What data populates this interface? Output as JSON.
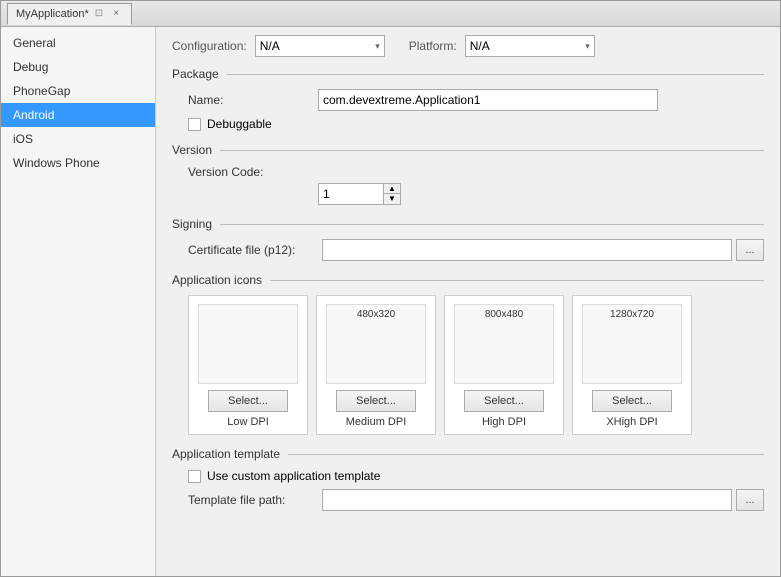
{
  "window": {
    "title": "MyApplication*",
    "close_label": "×",
    "pin_label": "📌"
  },
  "toolbar": {
    "configuration_label": "Configuration:",
    "configuration_value": "N/A",
    "platform_label": "Platform:",
    "platform_value": "N/A"
  },
  "sidebar": {
    "items": [
      {
        "id": "general",
        "label": "General",
        "active": false
      },
      {
        "id": "debug",
        "label": "Debug",
        "active": false
      },
      {
        "id": "phonegap",
        "label": "PhoneGap",
        "active": false
      },
      {
        "id": "android",
        "label": "Android",
        "active": true
      },
      {
        "id": "ios",
        "label": "iOS",
        "active": false
      },
      {
        "id": "windows-phone",
        "label": "Windows Phone",
        "active": false
      }
    ]
  },
  "sections": {
    "package": {
      "title": "Package",
      "name_label": "Name:",
      "name_value": "com.devextreme.Application1",
      "debuggable_label": "Debuggable"
    },
    "version": {
      "title": "Version",
      "version_code_label": "Version Code:",
      "version_code_value": "1"
    },
    "signing": {
      "title": "Signing",
      "certificate_label": "Certificate file (p12):",
      "certificate_value": "",
      "browse_label": "..."
    },
    "application_icons": {
      "title": "Application icons",
      "icons": [
        {
          "size": "",
          "dpi": "Low DPI",
          "select_label": "Select..."
        },
        {
          "size": "480x320",
          "dpi": "Medium DPI",
          "select_label": "Select..."
        },
        {
          "size": "800x480",
          "dpi": "High DPI",
          "select_label": "Select..."
        },
        {
          "size": "1280x720",
          "dpi": "XHigh DPI",
          "select_label": "Select..."
        }
      ]
    },
    "application_template": {
      "title": "Application template",
      "use_custom_label": "Use custom application template",
      "template_path_label": "Template file path:",
      "template_path_value": "",
      "browse_label": "..."
    }
  },
  "icons": {
    "dropdown_arrow": "▾",
    "spin_up": "▲",
    "spin_down": "▼"
  }
}
